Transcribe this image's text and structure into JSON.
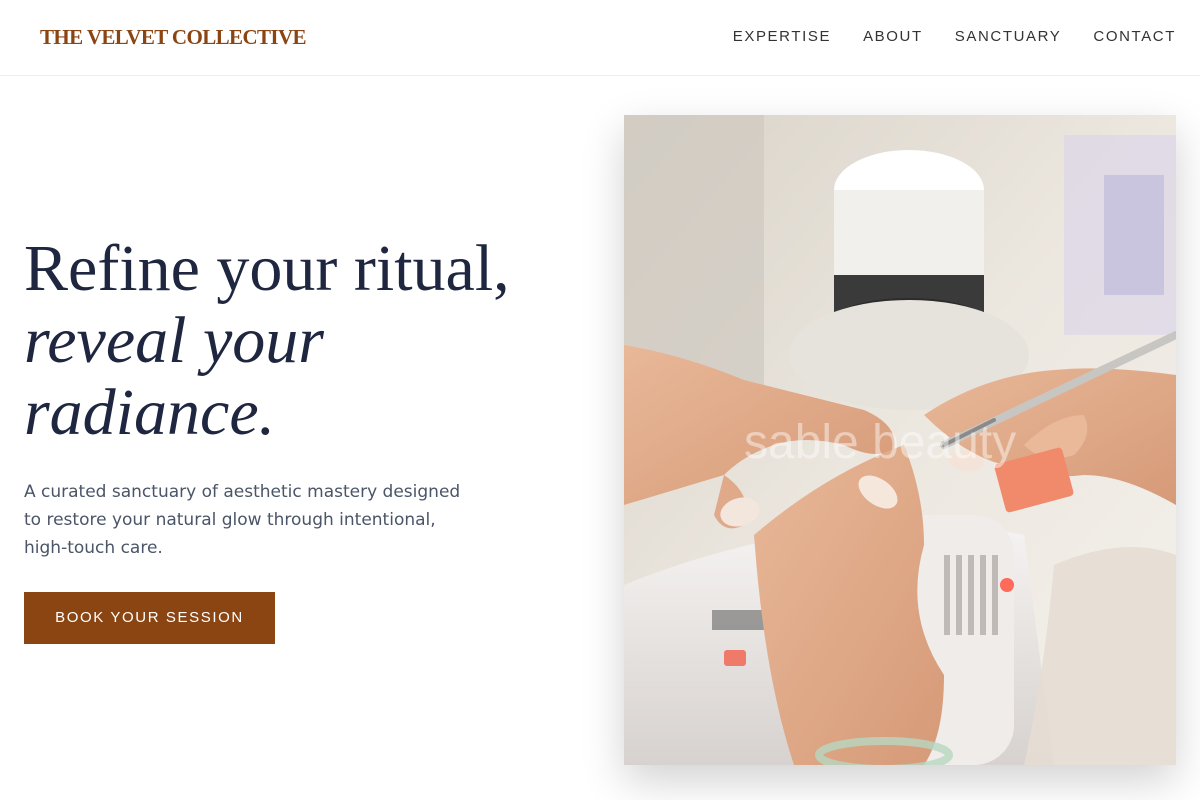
{
  "nav": {
    "brand": "THE VELVET COLLECTIVE",
    "links": [
      "EXPERTISE",
      "ABOUT",
      "SANCTUARY",
      "CONTACT"
    ]
  },
  "hero": {
    "title_lines": [
      "Refine your ritual,",
      "reveal your",
      "radiance."
    ],
    "description_lines": [
      "A curated sanctuary of aesthetic mastery designed",
      "to restore your natural glow through intentional,",
      "high-touch care."
    ],
    "cta_label": "BOOK YOUR SESSION",
    "image": {
      "watermark": "sable beauty"
    }
  },
  "colors": {
    "brand": "#8b4513",
    "heading": "#1e2640",
    "body_text": "#4a5568"
  }
}
